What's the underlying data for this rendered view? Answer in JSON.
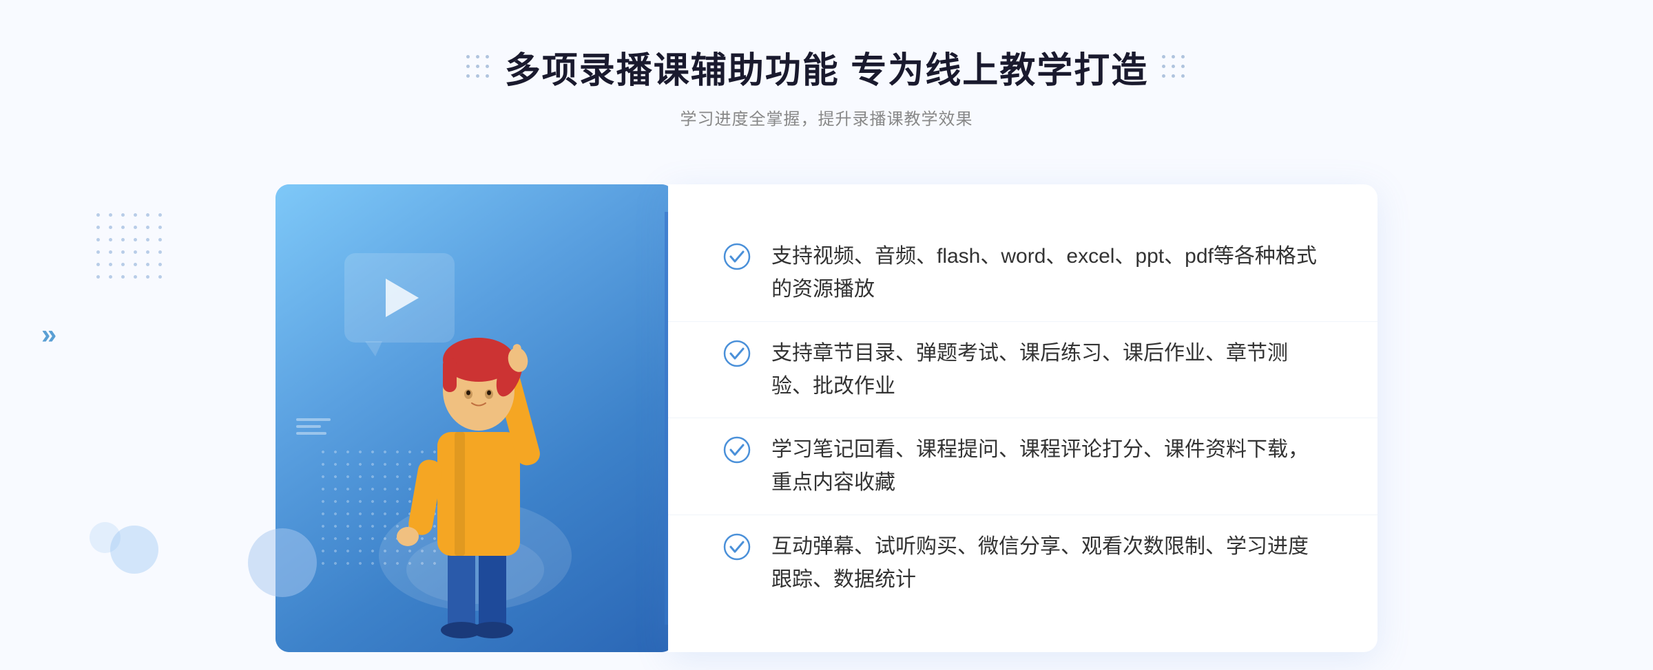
{
  "header": {
    "title": "多项录播课辅助功能 专为线上教学打造",
    "subtitle": "学习进度全掌握，提升录播课教学效果"
  },
  "features": [
    {
      "id": "feature-1",
      "text": "支持视频、音频、flash、word、excel、ppt、pdf等各种格式的资源播放"
    },
    {
      "id": "feature-2",
      "text": "支持章节目录、弹题考试、课后练习、课后作业、章节测验、批改作业"
    },
    {
      "id": "feature-3",
      "text": "学习笔记回看、课程提问、课程评论打分、课件资料下载，重点内容收藏"
    },
    {
      "id": "feature-4",
      "text": "互动弹幕、试听购买、微信分享、观看次数限制、学习进度跟踪、数据统计"
    }
  ],
  "decoration": {
    "left_arrow": "»",
    "check_icon_color": "#4a90d9"
  }
}
